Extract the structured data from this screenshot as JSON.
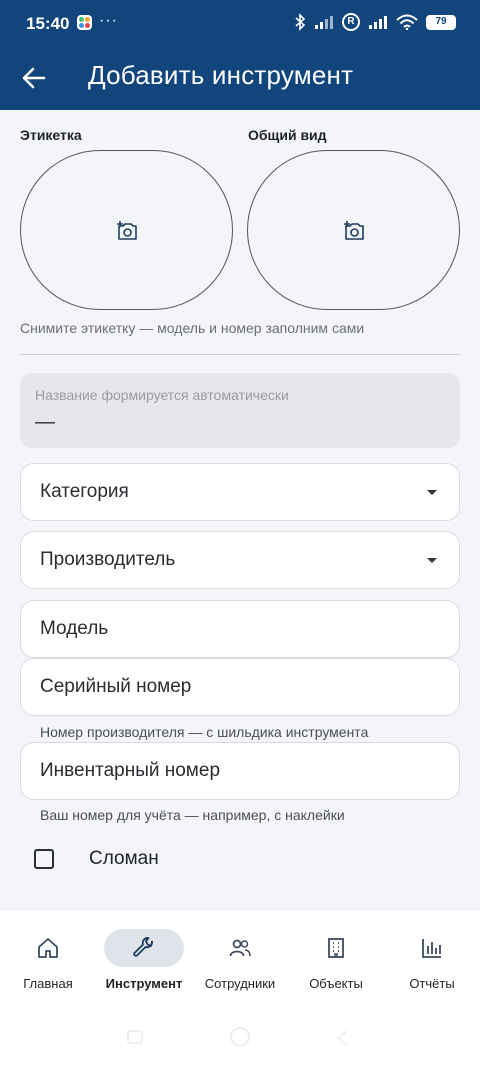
{
  "status_bar": {
    "time": "15:40",
    "overflow": "···",
    "reg_badge": "R",
    "battery": "79",
    "color": "#11457c"
  },
  "app_bar": {
    "back_icon": "arrow-left-icon",
    "title": "Добавить инструмент"
  },
  "photos": {
    "label_photo": "Этикетка",
    "general_photo": "Общий вид",
    "camera_icon": "add-a-photo-icon",
    "hint": "Снимите этикетку — модель и номер заполним сами"
  },
  "auto_name": {
    "label": "Название формируется автоматически",
    "value": "—"
  },
  "form": {
    "category": "Категория",
    "manufacturer": "Производитель",
    "model": "Модель",
    "serial": "Серийный номер",
    "serial_hint": "Номер производителя — с шильдика инструмента",
    "inventory": "Инвентарный номер",
    "inventory_hint": "Ваш номер для учёта — например, с наклейки",
    "broken_label": "Сломан",
    "broken_checked": false
  },
  "bottom_nav": {
    "items": [
      {
        "label": "Главная",
        "icon": "home-icon"
      },
      {
        "label": "Инструмент",
        "icon": "wrench-icon",
        "active": true
      },
      {
        "label": "Сотрудники",
        "icon": "people-icon"
      },
      {
        "label": "Объекты",
        "icon": "building-icon"
      },
      {
        "label": "Отчёты",
        "icon": "bar-chart-icon"
      }
    ]
  }
}
